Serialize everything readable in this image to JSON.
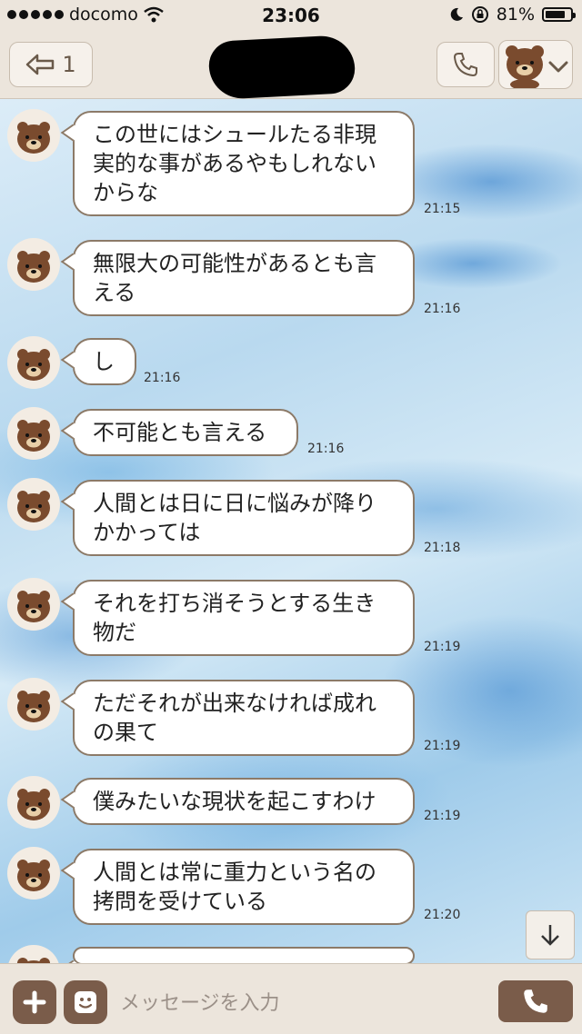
{
  "status_bar": {
    "carrier": "docomo",
    "time": "23:06",
    "battery": "81%",
    "battery_level": 0.81,
    "icons": [
      "signal-dots-icon",
      "wifi-icon",
      "moon-icon",
      "rotation-lock-icon",
      "battery-icon"
    ]
  },
  "header": {
    "back_count": "1",
    "icons": [
      "back-arrow-icon",
      "phone-icon",
      "bear-sticker-icon",
      "chevron-down-icon"
    ]
  },
  "messages": [
    {
      "text": "この世にはシュールたる非現実的な事があるやもしれないからな",
      "lines": [
        "この世にはシュールたる非現",
        "実的な事があるやもしれない",
        "からな"
      ],
      "time": "21:15"
    },
    {
      "text": "無限大の可能性があるとも言える",
      "lines": [
        "無限大の可能性があるとも言",
        "える"
      ],
      "time": "21:16"
    },
    {
      "text": "し",
      "lines": [
        "し"
      ],
      "time": "21:16"
    },
    {
      "text": "不可能とも言える",
      "lines": [
        "不可能とも言える"
      ],
      "time": "21:16"
    },
    {
      "text": "人間とは日に日に悩みが降りかかっては",
      "lines": [
        "人間とは日に日に悩みが降り",
        "かかっては"
      ],
      "time": "21:18"
    },
    {
      "text": "それを打ち消そうとする生き物だ",
      "lines": [
        "それを打ち消そうとする生き",
        "物だ"
      ],
      "time": "21:19"
    },
    {
      "text": "ただそれが出来なければ成れの果て",
      "lines": [
        "ただそれが出来なければ成れ",
        "の果て"
      ],
      "time": "21:19"
    },
    {
      "text": "僕みたいな現状を起こすわけ",
      "lines": [
        "僕みたいな現状を起こすわけ"
      ],
      "time": "21:19"
    },
    {
      "text": "人間とは常に重力という名の拷問を受けている",
      "lines": [
        "人間とは常に重力という名の",
        "拷問を受けている"
      ],
      "time": "21:20"
    },
    {
      "text": "",
      "lines": [
        ""
      ],
      "time": ""
    }
  ],
  "input": {
    "placeholder": "メッセージを入力",
    "icons": [
      "plus-icon",
      "smile-icon",
      "phone-icon"
    ]
  },
  "colors": {
    "bar_bg": "#ece5dc",
    "bubble_border": "#8c7a68",
    "button_brown": "#7a5c4a"
  }
}
